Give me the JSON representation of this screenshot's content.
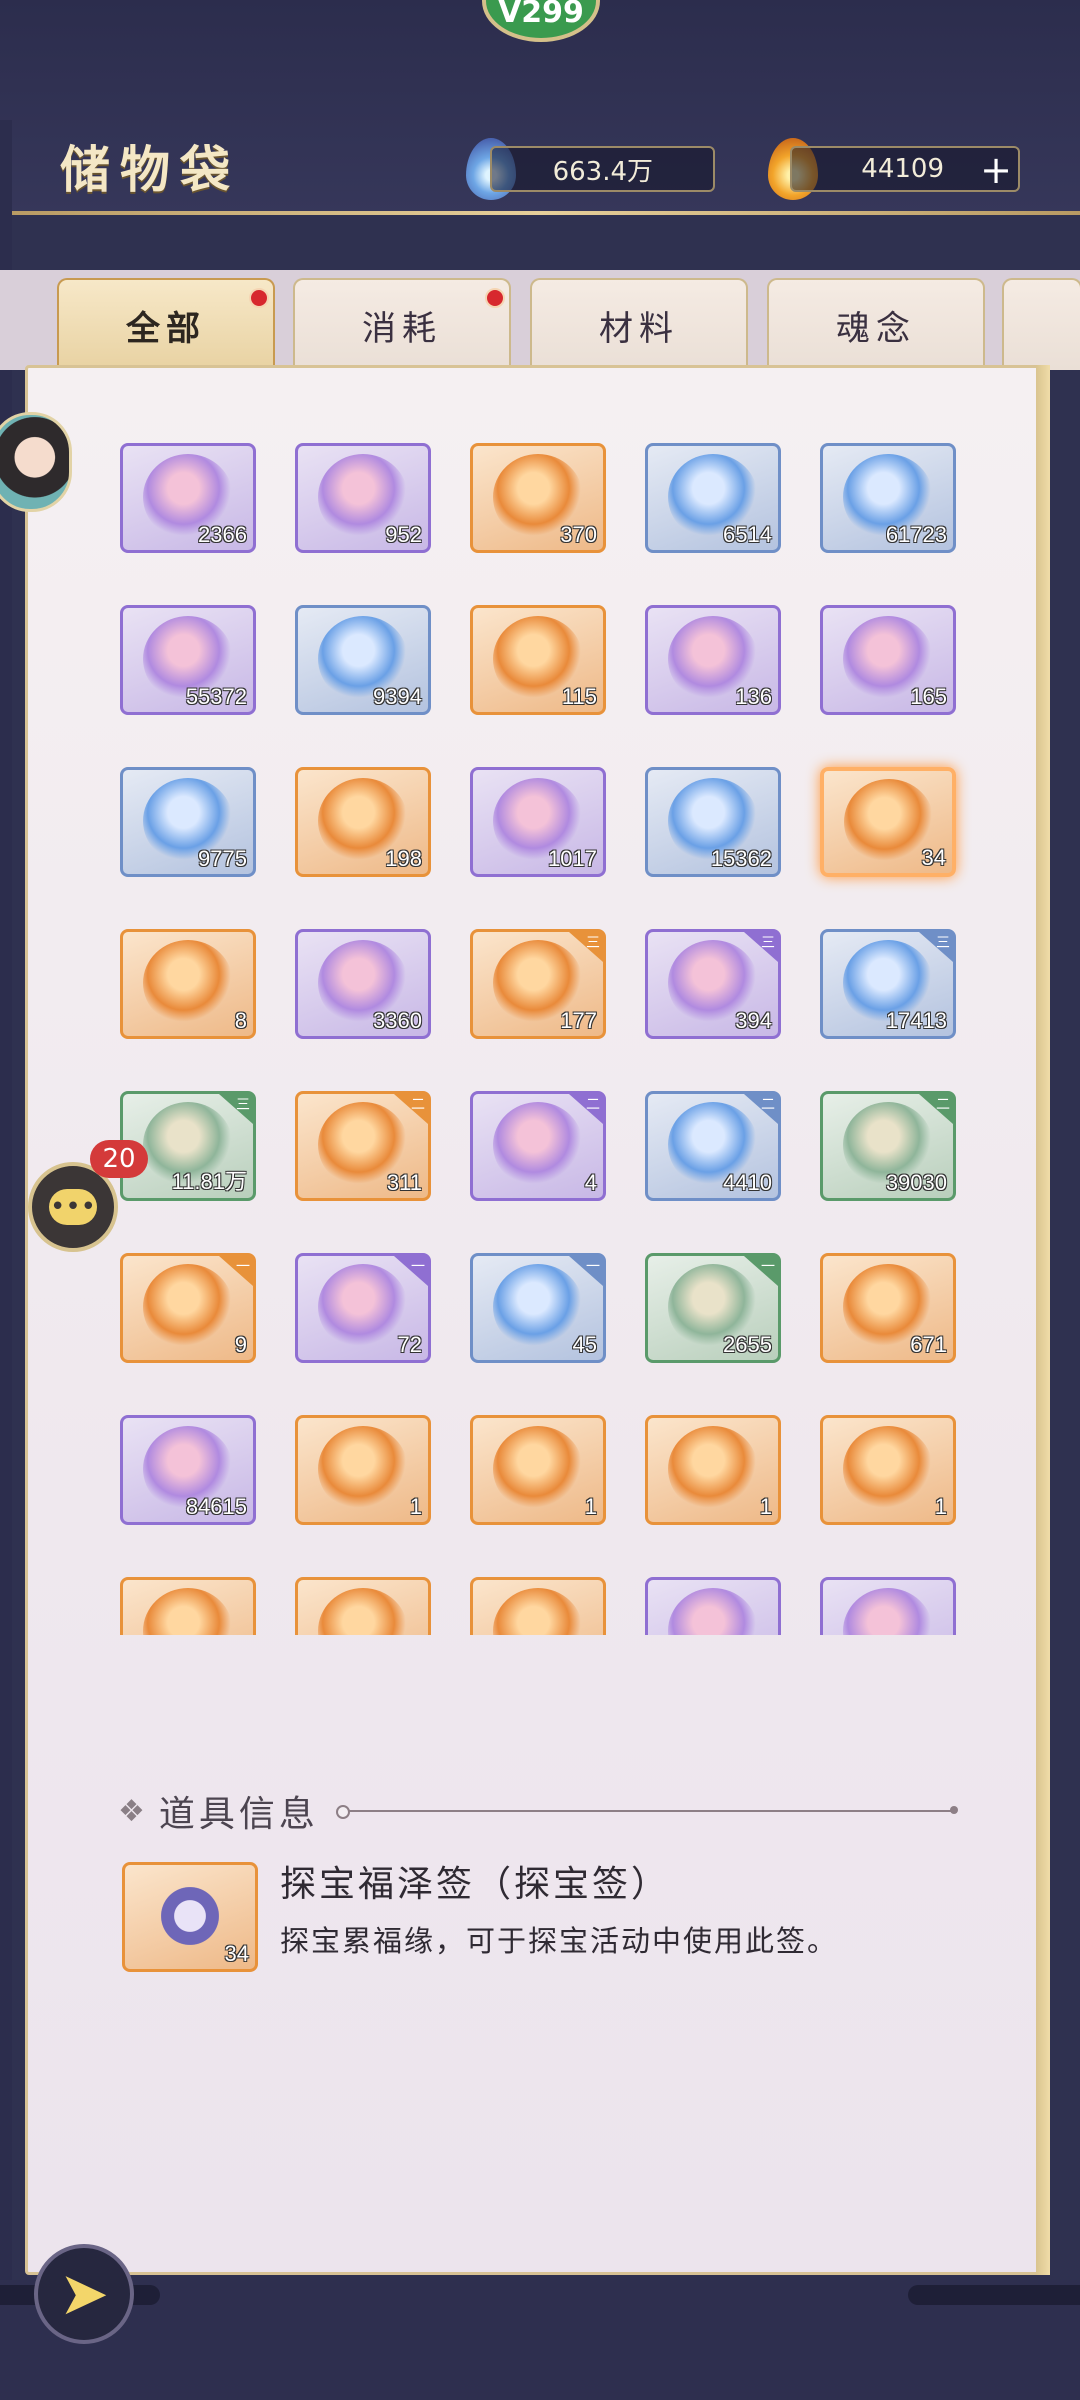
{
  "header": {
    "title": "储物袋",
    "top_badge": "V299",
    "currency1": {
      "value": "663.4万",
      "icon": "spirit-stone-icon"
    },
    "currency2": {
      "value": "44109",
      "icon": "flame-coin-icon"
    },
    "plus_label": "+"
  },
  "tabs": [
    {
      "label": "全部",
      "active": true,
      "dot": true
    },
    {
      "label": "消耗",
      "active": false,
      "dot": true
    },
    {
      "label": "材料",
      "active": false,
      "dot": false
    },
    {
      "label": "魂念",
      "active": false,
      "dot": false
    }
  ],
  "chat": {
    "badge": "20"
  },
  "items": [
    {
      "count": "2366",
      "rarity": "purple"
    },
    {
      "count": "952",
      "rarity": "purple"
    },
    {
      "count": "370",
      "rarity": "orange"
    },
    {
      "count": "6514",
      "rarity": "blue"
    },
    {
      "count": "61723",
      "rarity": "blue"
    },
    {
      "count": "55372",
      "rarity": "purple"
    },
    {
      "count": "9394",
      "rarity": "blue"
    },
    {
      "count": "115",
      "rarity": "orange"
    },
    {
      "count": "136",
      "rarity": "purple"
    },
    {
      "count": "165",
      "rarity": "purple"
    },
    {
      "count": "9775",
      "rarity": "blue"
    },
    {
      "count": "198",
      "rarity": "orange"
    },
    {
      "count": "1017",
      "rarity": "purple"
    },
    {
      "count": "15362",
      "rarity": "blue"
    },
    {
      "count": "34",
      "rarity": "orange",
      "selected": true
    },
    {
      "count": "8",
      "rarity": "orange"
    },
    {
      "count": "3360",
      "rarity": "purple"
    },
    {
      "count": "177",
      "rarity": "orange",
      "tier": "三"
    },
    {
      "count": "394",
      "rarity": "purple",
      "tier": "三"
    },
    {
      "count": "17413",
      "rarity": "blue",
      "tier": "三"
    },
    {
      "count": "11.81万",
      "rarity": "green",
      "tier": "三"
    },
    {
      "count": "311",
      "rarity": "orange",
      "tier": "二"
    },
    {
      "count": "4",
      "rarity": "purple",
      "tier": "二"
    },
    {
      "count": "4410",
      "rarity": "blue",
      "tier": "二"
    },
    {
      "count": "39030",
      "rarity": "green",
      "tier": "二"
    },
    {
      "count": "9",
      "rarity": "orange",
      "tier": "一"
    },
    {
      "count": "72",
      "rarity": "purple",
      "tier": "一"
    },
    {
      "count": "45",
      "rarity": "blue",
      "tier": "一"
    },
    {
      "count": "2655",
      "rarity": "green",
      "tier": "一"
    },
    {
      "count": "671",
      "rarity": "orange"
    },
    {
      "count": "84615",
      "rarity": "purple"
    },
    {
      "count": "1",
      "rarity": "orange"
    },
    {
      "count": "1",
      "rarity": "orange"
    },
    {
      "count": "1",
      "rarity": "orange"
    },
    {
      "count": "1",
      "rarity": "orange"
    },
    {
      "count": "",
      "rarity": "orange"
    },
    {
      "count": "",
      "rarity": "orange"
    },
    {
      "count": "",
      "rarity": "orange"
    },
    {
      "count": "",
      "rarity": "purple"
    },
    {
      "count": "",
      "rarity": "purple"
    }
  ],
  "info": {
    "header": "道具信息",
    "name": "探宝福泽签（探宝签）",
    "description": "探宝累福缘，可于探宝活动中使用此签。",
    "count": "34"
  },
  "colors": {
    "purple": "#8f6fd2",
    "orange": "#e8923a",
    "blue": "#6f8fc7",
    "green": "#5a9a6a"
  }
}
